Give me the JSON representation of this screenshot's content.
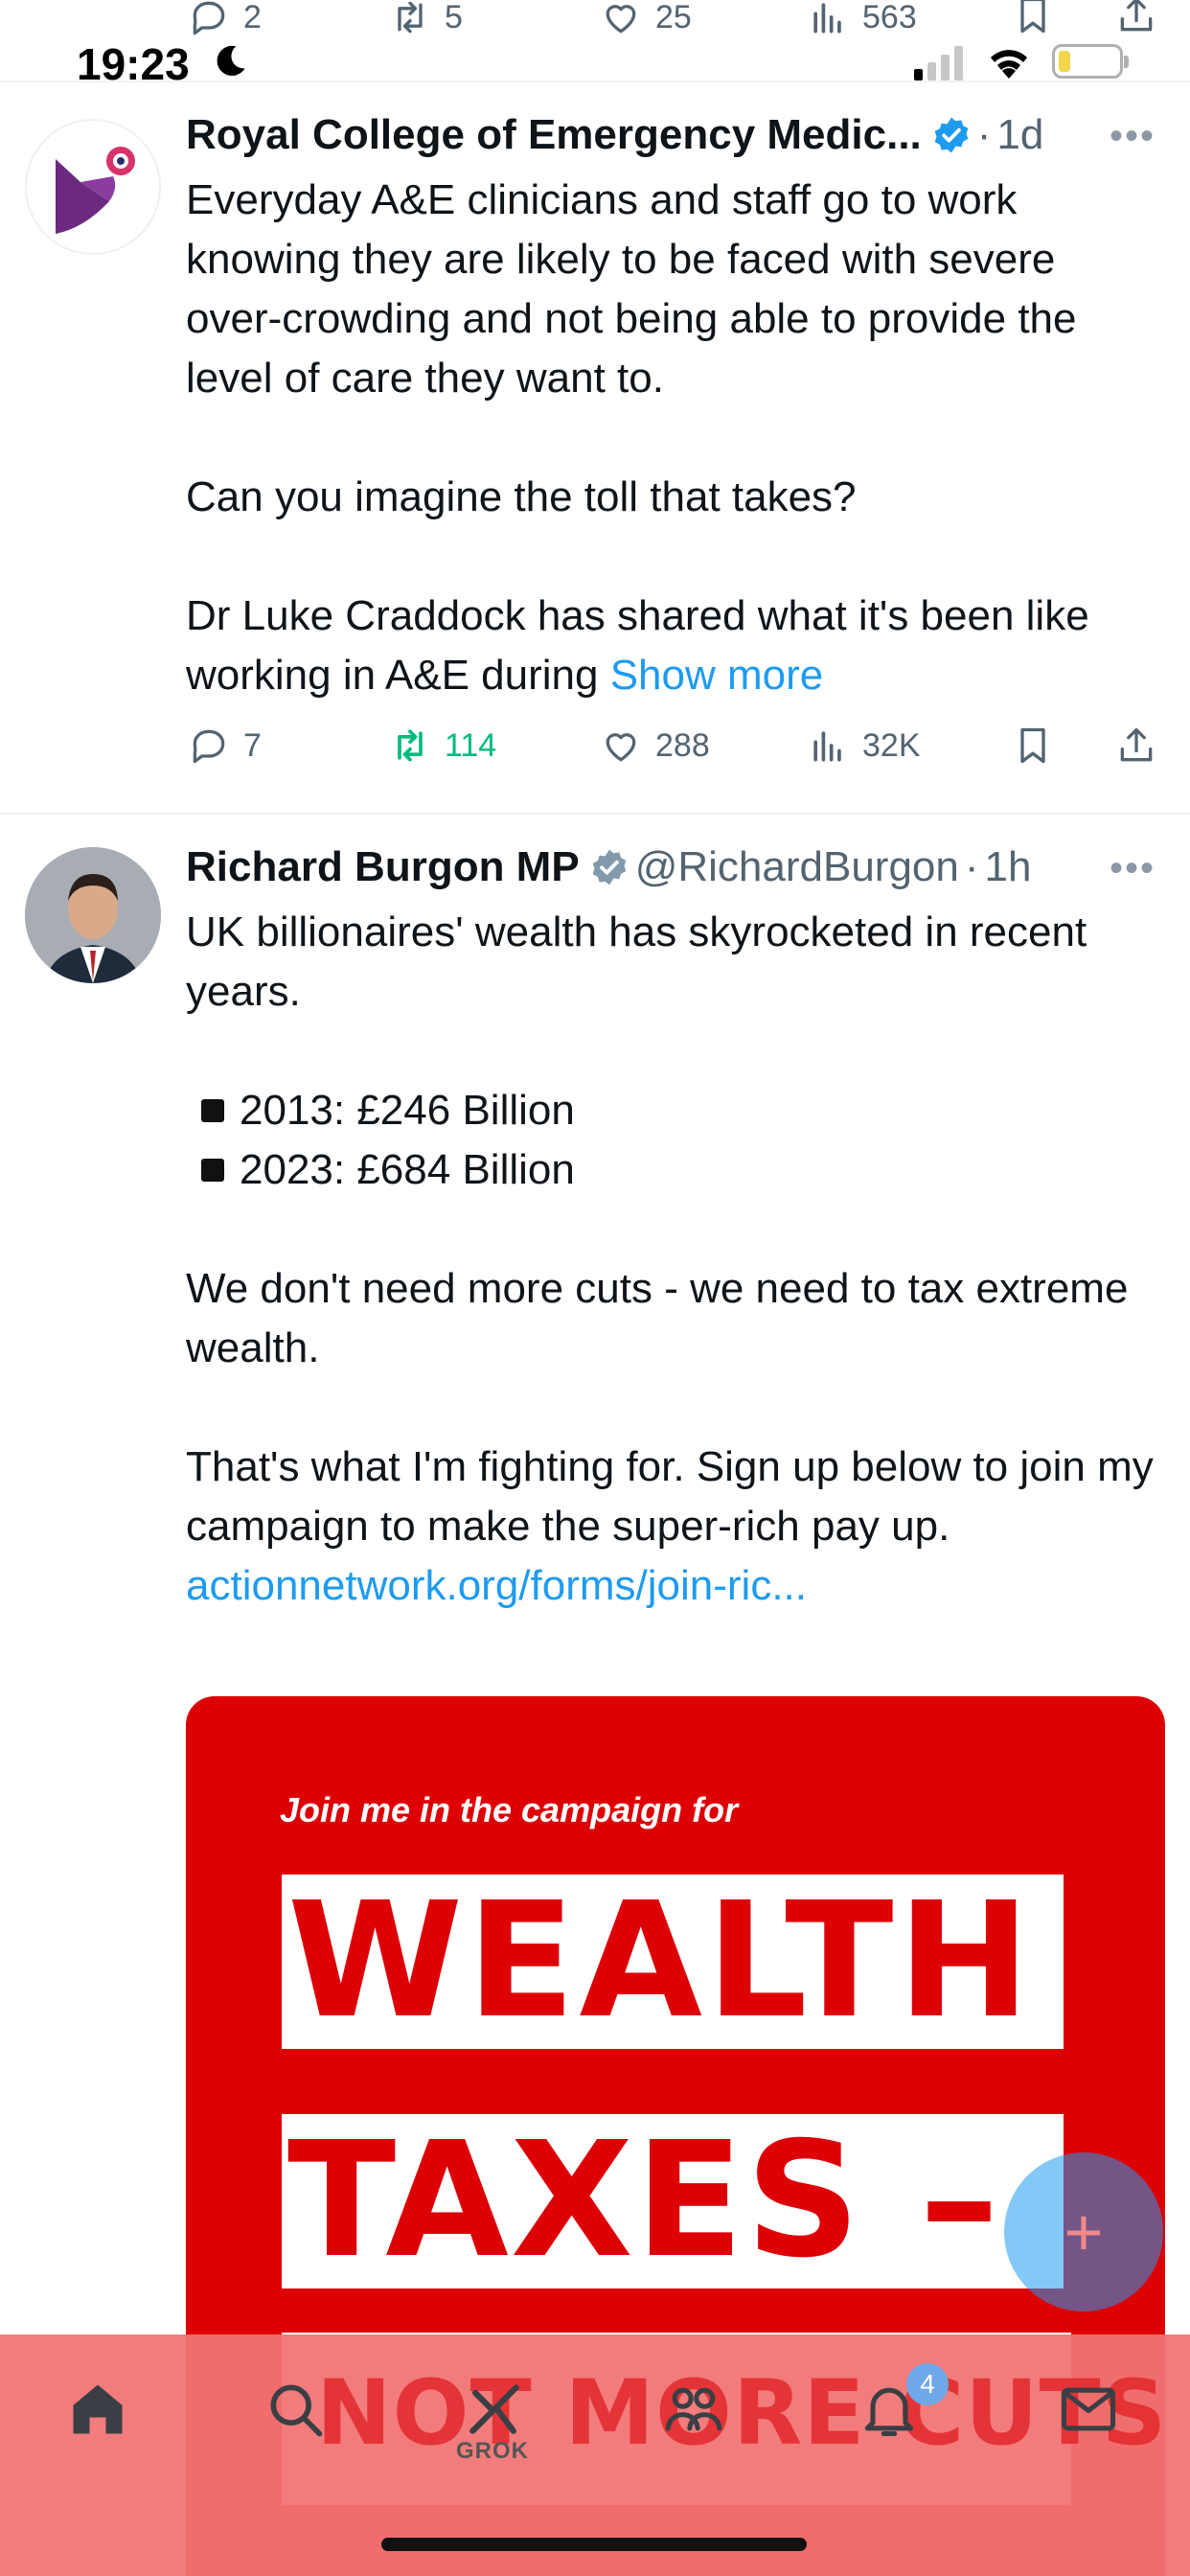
{
  "status_bar": {
    "time": "19:23"
  },
  "top_actions": {
    "replies": "2",
    "reposts": "5",
    "likes": "25",
    "views": "563"
  },
  "tweet1": {
    "name": "Royal College of Emergency Medic...",
    "dot": "·",
    "time": "1d",
    "text1": "Everyday A&E clinicians and staff go to work knowing they are likely to be faced with severe over-crowding and not being able to provide the level of care they want to.",
    "text2": "Can you imagine the toll that takes?",
    "text3": "Dr Luke Craddock has shared what it's been like working in A&E during",
    "show_more": "Show more",
    "replies": "7",
    "reposts": "114",
    "likes": "288",
    "views": "32K"
  },
  "tweet2": {
    "name": "Richard Burgon MP",
    "handle": "@RichardBurgon",
    "dot": "·",
    "time": "1h",
    "text1": "UK billionaires' wealth has skyrocketed in recent years.",
    "bullet1": "2013: £246 Billion",
    "bullet2": "2023: £684 Billion",
    "text2": "We don't need more cuts - we need to tax extreme wealth.",
    "text3": "That's what I'm fighting for. Sign up below to join my campaign to make the super-rich pay up.",
    "link": "actionnetwork.org/forms/join-ric...",
    "image": {
      "subtitle": "Join me in the campaign for",
      "line1": "WEALTH",
      "line2": "TAXES –",
      "line3": "NOT MORE CUTS"
    }
  },
  "fab": {
    "icon": "plus-icon",
    "label": "+"
  },
  "bottom_nav": {
    "grok_label": "GROK",
    "notification_count": "4",
    "items": [
      "home-icon",
      "search-icon",
      "grok-icon",
      "communities-icon",
      "notifications-icon",
      "messages-icon"
    ]
  },
  "colors": {
    "accent": "#1d9bf0",
    "repost_active": "#00ba7c",
    "campaign_red": "#dd0106",
    "text_secondary": "#536471"
  }
}
